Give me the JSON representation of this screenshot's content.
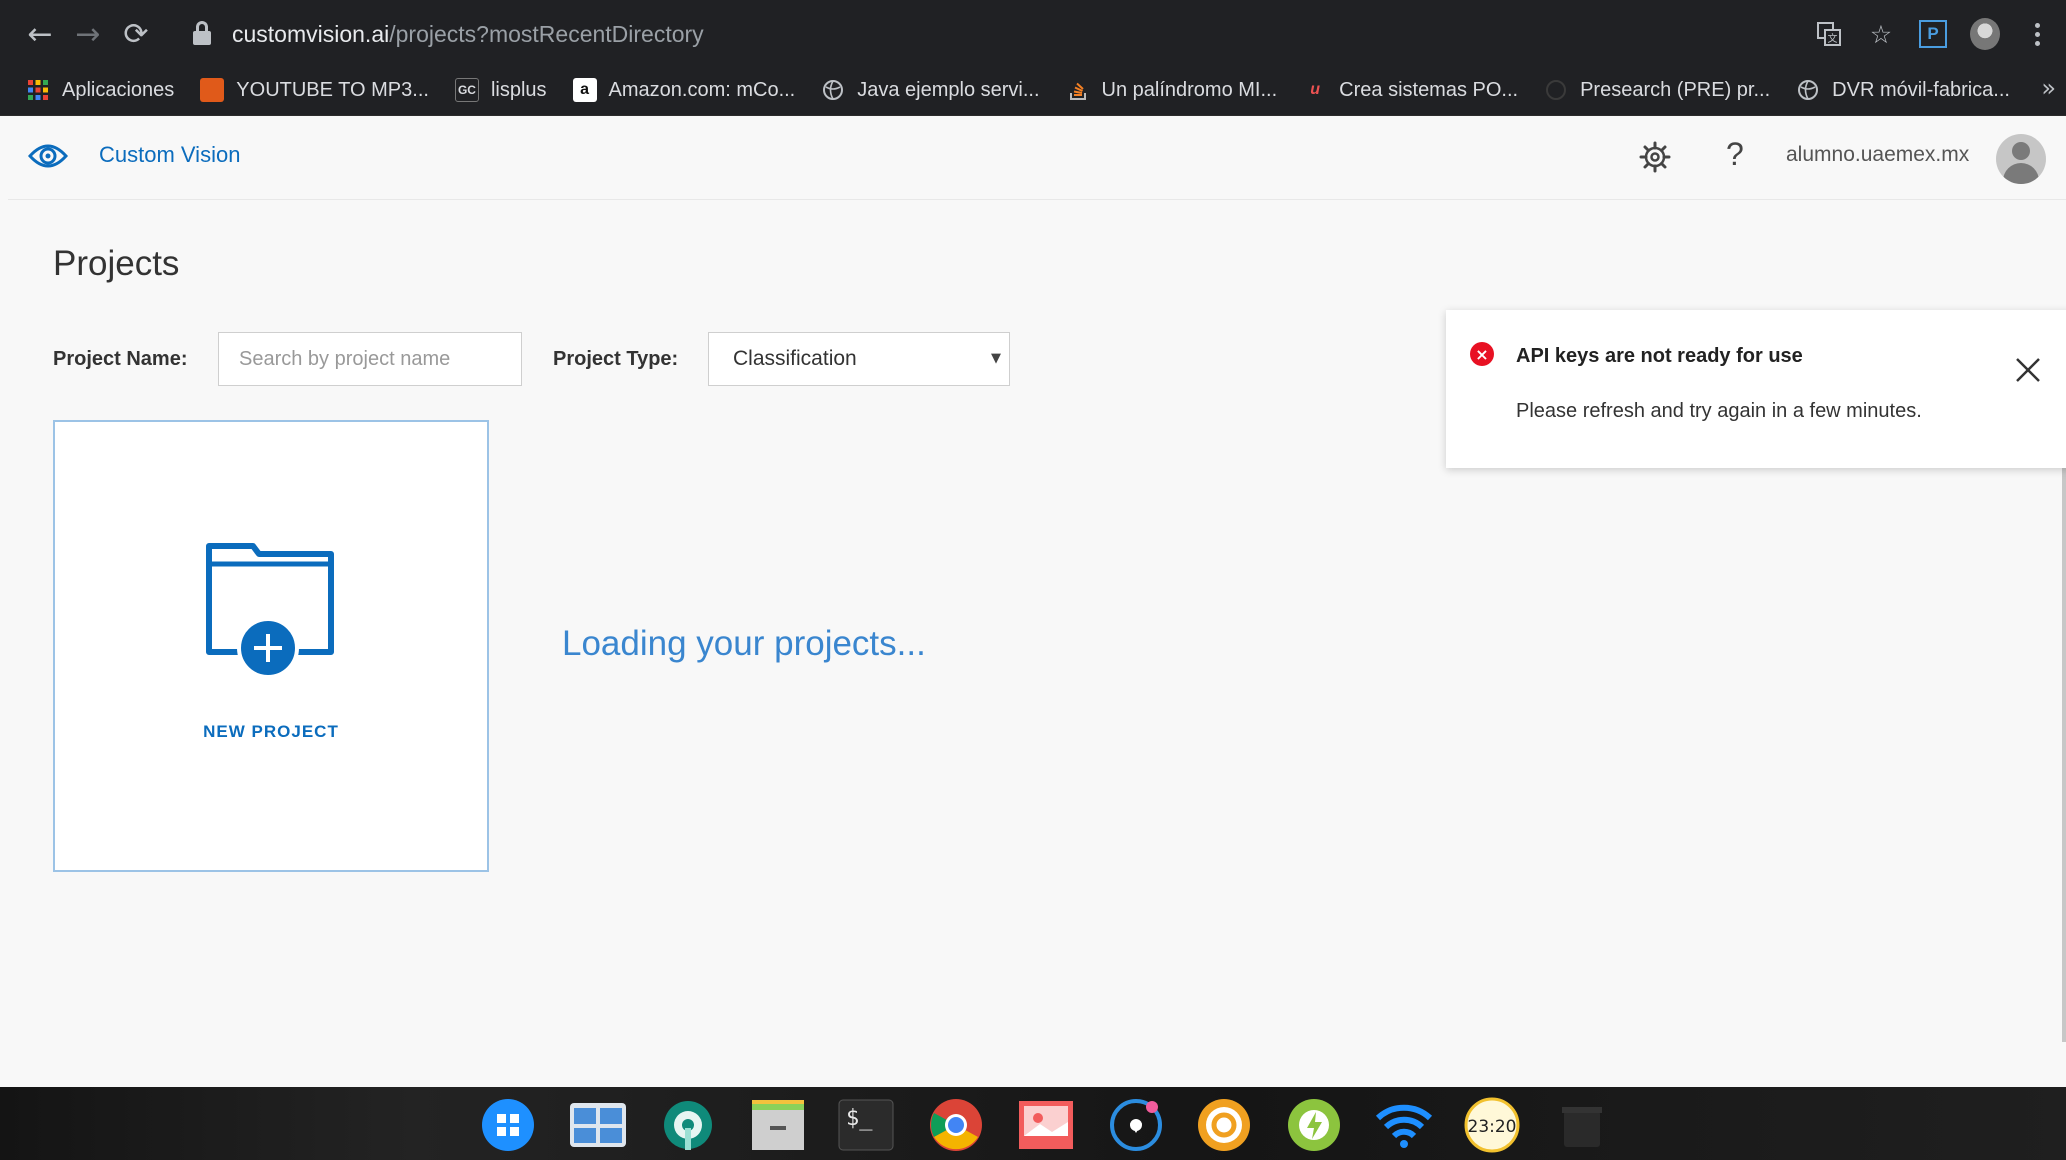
{
  "browser": {
    "url_host": "customvision.ai",
    "url_path": "/projects?mostRecentDirectory",
    "nav": {
      "back": "←",
      "forward": "→",
      "reload": "⟳"
    },
    "bookmarks": [
      {
        "label": "Aplicaciones",
        "icon": "apps-grid-icon"
      },
      {
        "label": "YOUTUBE TO MP3...",
        "icon": "youtube-mp3-icon"
      },
      {
        "label": "lisplus",
        "icon": "lisplus-icon"
      },
      {
        "label": "Amazon.com: mCo...",
        "icon": "amazon-icon"
      },
      {
        "label": "Java ejemplo servi...",
        "icon": "globe-icon"
      },
      {
        "label": "Un palíndromo MI...",
        "icon": "stackoverflow-icon"
      },
      {
        "label": "Crea sistemas PO...",
        "icon": "udemy-icon"
      },
      {
        "label": "Presearch (PRE) pr...",
        "icon": "presearch-icon"
      },
      {
        "label": "DVR móvil-fabrica...",
        "icon": "globe-icon"
      }
    ],
    "bookmarks_more": "»"
  },
  "header": {
    "brand": "Custom Vision",
    "help": "?",
    "user": "alumno.uaemex.mx"
  },
  "page": {
    "title": "Projects",
    "filter_name_label": "Project Name:",
    "search_placeholder": "Search by project name",
    "filter_type_label": "Project Type:",
    "project_type_selected": "Classification",
    "new_project_label": "NEW PROJECT",
    "loading_text": "Loading your projects..."
  },
  "toast": {
    "title": "API keys are not ready for use",
    "message": "Please refresh and try again in a few minutes."
  },
  "dock": {
    "apps": [
      {
        "name": "launcher-icon"
      },
      {
        "name": "multitasking-icon"
      },
      {
        "name": "control-center-icon"
      },
      {
        "name": "file-manager-icon"
      },
      {
        "name": "terminal-icon"
      },
      {
        "name": "chrome-icon"
      },
      {
        "name": "image-viewer-icon"
      },
      {
        "name": "music-icon"
      },
      {
        "name": "app-store-icon"
      },
      {
        "name": "power-icon"
      },
      {
        "name": "wifi-icon"
      },
      {
        "name": "clock-icon",
        "text": "23:20"
      },
      {
        "name": "trash-icon"
      }
    ]
  },
  "colors": {
    "brand_blue": "#0b6cbd",
    "loading_blue": "#3a86cf",
    "error_red": "#e81123"
  }
}
